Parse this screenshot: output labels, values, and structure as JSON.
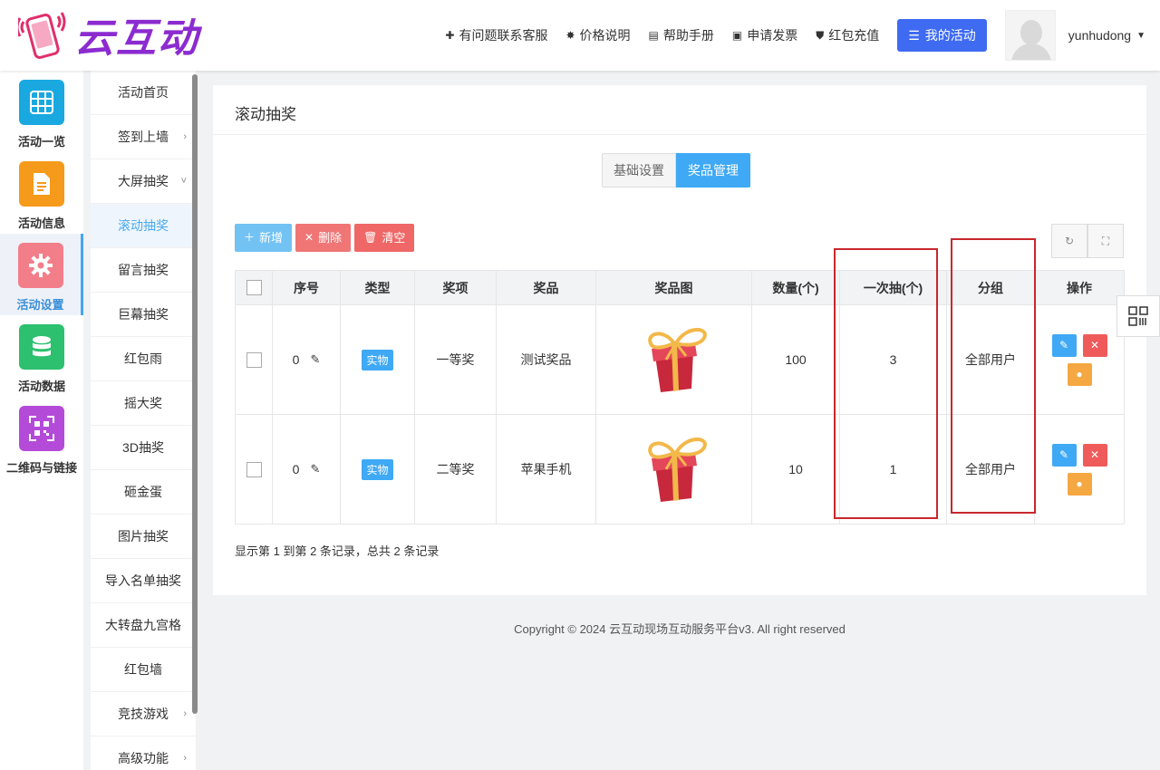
{
  "brand": {
    "name": "云互动"
  },
  "topnav": {
    "items": [
      {
        "icon": "user-plus-icon",
        "label": "有问题联系客服"
      },
      {
        "icon": "badge-icon",
        "label": "价格说明"
      },
      {
        "icon": "book-icon",
        "label": "帮助手册"
      },
      {
        "icon": "printer-icon",
        "label": "申请发票"
      },
      {
        "icon": "shield-icon",
        "label": "红包充值"
      }
    ],
    "my_activity": "我的活动",
    "username": "yunhudong"
  },
  "iconbar": {
    "items": [
      {
        "label": "活动一览",
        "color": "#1aa8e0",
        "icon": "grid-icon"
      },
      {
        "label": "活动信息",
        "color": "#f59a1b",
        "icon": "document-icon"
      },
      {
        "label": "活动设置",
        "color": "#f27e8a",
        "icon": "gear-icon",
        "active": true
      },
      {
        "label": "活动数据",
        "color": "#2cc06f",
        "icon": "database-icon"
      },
      {
        "label": "二维码与链接",
        "color": "#b44bd8",
        "icon": "qrcode-icon"
      }
    ]
  },
  "submenu": {
    "items": [
      {
        "label": "活动首页"
      },
      {
        "label": "签到上墙",
        "arrow": "›"
      },
      {
        "label": "大屏抽奖",
        "arrow": "˅"
      },
      {
        "label": "滚动抽奖",
        "active": true
      },
      {
        "label": "留言抽奖"
      },
      {
        "label": "巨幕抽奖"
      },
      {
        "label": "红包雨"
      },
      {
        "label": "摇大奖"
      },
      {
        "label": "3D抽奖"
      },
      {
        "label": "砸金蛋"
      },
      {
        "label": "图片抽奖"
      },
      {
        "label": "导入名单抽奖"
      },
      {
        "label": "大转盘九宫格"
      },
      {
        "label": "红包墙"
      },
      {
        "label": "竞技游戏",
        "arrow": "›"
      },
      {
        "label": "高级功能",
        "arrow": "›"
      }
    ]
  },
  "panel": {
    "title": "滚动抽奖",
    "tabs": [
      {
        "label": "基础设置"
      },
      {
        "label": "奖品管理"
      }
    ],
    "toolbar": {
      "add": "新增",
      "delete": "删除",
      "clear": "清空"
    },
    "table": {
      "headers": [
        "序号",
        "类型",
        "奖项",
        "奖品",
        "奖品图",
        "数量(个)",
        "一次抽(个)",
        "分组",
        "操作"
      ],
      "rows": [
        {
          "seq": "0",
          "type": "实物",
          "award": "一等奖",
          "prize": "测试奖品",
          "quantity": "100",
          "per_draw": "3",
          "group": "全部用户"
        },
        {
          "seq": "0",
          "type": "实物",
          "award": "二等奖",
          "prize": "苹果手机",
          "quantity": "10",
          "per_draw": "1",
          "group": "全部用户"
        }
      ]
    },
    "summary": "显示第 1 到第 2 条记录，总共 2 条记录"
  },
  "footer": {
    "copyright": "Copyright © 2024 云互动现场互动服务平台v3. All right reserved"
  }
}
